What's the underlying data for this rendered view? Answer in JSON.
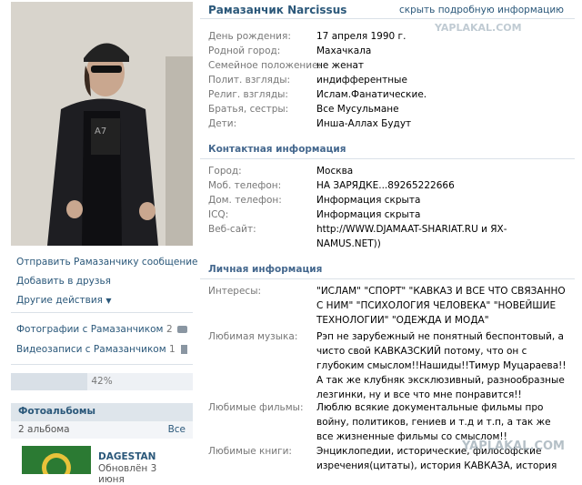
{
  "profile": {
    "name": "Рамазанчик Narcissus",
    "hide_link": "скрыть подробную информацию"
  },
  "info": [
    {
      "label": "День рождения:",
      "value": "17 апреля 1990 г."
    },
    {
      "label": "Родной город:",
      "value": "Махачкала"
    },
    {
      "label": "Семейное положение:",
      "value": "не женат"
    },
    {
      "label": "Полит. взгляды:",
      "value": "индифферентные"
    },
    {
      "label": "Религ. взгляды:",
      "value": "Ислам.Фанатические."
    },
    {
      "label": "Братья, сестры:",
      "value": "Все Мусульмане"
    },
    {
      "label": "Дети:",
      "value": "Инша-Аллах Будут"
    }
  ],
  "contact": {
    "title": "Контактная информация",
    "rows": [
      {
        "label": "Город:",
        "value": "Москва"
      },
      {
        "label": "Моб. телефон:",
        "value": "НА ЗАРЯДКЕ...89265222666"
      },
      {
        "label": "Дом. телефон:",
        "value": "Информация скрыта"
      },
      {
        "label": "ICQ:",
        "value": "Информация скрыта"
      },
      {
        "label": "Веб-сайт:",
        "value": "http://WWW.DJAMAAT-SHARIAT.RU и ЯХ-NAMUS.NET))"
      }
    ]
  },
  "personal": {
    "title": "Личная информация",
    "rows": [
      {
        "label": "Интересы:",
        "value": "\"ИСЛАМ\" \"СПОРТ\" \"КАВКАЗ И ВСЕ ЧТО СВЯЗАННО С НИМ\" \"ПСИХОЛОГИЯ ЧЕЛОВЕКА\" \"НОВЕЙШИЕ ТЕХНОЛОГИИ\" \"ОДЕЖДА И МОДА\""
      },
      {
        "label": "Любимая музыка:",
        "value": "Рэп не зарубежный не понятный беспонтовый, а чисто свой КАВКАЗСКИЙ потому, что он с глубоким смыслом!!Нашиды!!Тимур Муцараева!! А так же клубняк эксклюзивный, разнообразные лезгинки, ну и все что мне понравится!!"
      },
      {
        "label": "Любимые фильмы:",
        "value": "Люблю всякие документальные фильмы про войну, политиков, гениев и т.д и т.п, а так же все жизненные фильмы со смыслом!!"
      },
      {
        "label": "Любимые книги:",
        "value": "Энциклопедии, исторические, философские изречения(цитаты), история КАВКАЗА, история"
      }
    ]
  },
  "actions": {
    "send_message": "Отправить Рамазанчику сообщение",
    "add_friend": "Добавить в друзья",
    "other": "Другие действия",
    "photos": "Фотографии с Рамазанчиком",
    "photos_count": "2",
    "videos": "Видеозаписи с Рамазанчиком",
    "videos_count": "1"
  },
  "progress": {
    "label": "42%",
    "value": 0.42
  },
  "albums": {
    "title": "Фотоальбомы",
    "count": "2 альбома",
    "all": "Все",
    "item_name": "DAGESTAN",
    "item_updated": "Обновлён 3 июня"
  },
  "watermark": {
    "top": "YAPLAKAL.COM",
    "bottom": "YAPLAKAL.COM"
  },
  "colors": {
    "link": "#2b587a",
    "section": "#45688e",
    "divider": "#dae1e8"
  }
}
